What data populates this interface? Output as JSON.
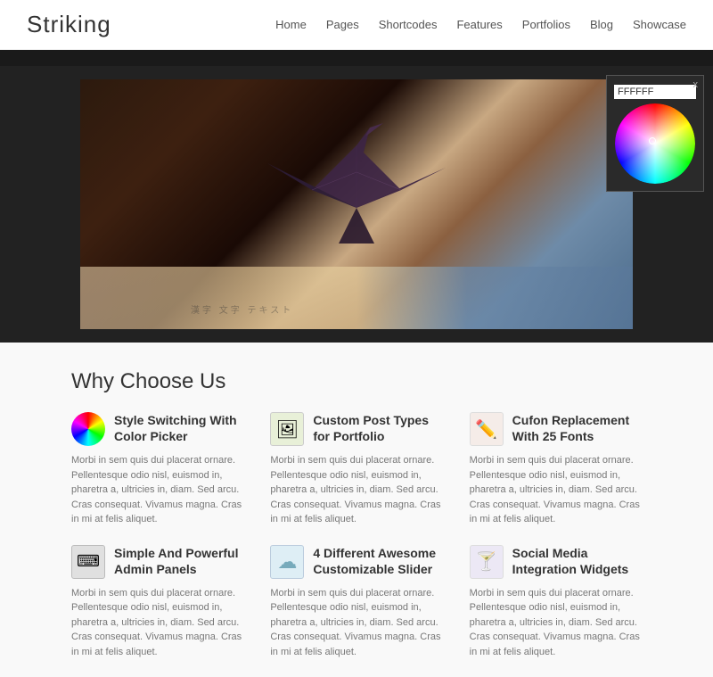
{
  "header": {
    "logo": "Striking",
    "nav": [
      {
        "label": "Home",
        "id": "home"
      },
      {
        "label": "Pages",
        "id": "pages"
      },
      {
        "label": "Shortcodes",
        "id": "shortcodes"
      },
      {
        "label": "Features",
        "id": "features"
      },
      {
        "label": "Portfolios",
        "id": "portfolios"
      },
      {
        "label": "Blog",
        "id": "blog"
      },
      {
        "label": "Showcase",
        "id": "showcase"
      }
    ]
  },
  "color_picker": {
    "hex_value": "FFFFFF",
    "close_label": "x"
  },
  "why_section": {
    "title": "Why Choose Us",
    "features": [
      {
        "id": "style-switching",
        "icon_type": "colorwheel",
        "title": "Style Switching With Color Picker",
        "desc": "Morbi in sem quis dui placerat ornare. Pellentesque odio nisl, euismod in, pharetra a, ultricies in, diam. Sed arcu. Cras consequat. Vivamus magna. Cras in mi at felis aliquet."
      },
      {
        "id": "custom-post",
        "icon_type": "custom-post",
        "title": "Custom Post Types for Portfolio",
        "desc": "Morbi in sem quis dui placerat ornare. Pellentesque odio nisl, euismod in, pharetra a, ultricies in, diam. Sed arcu. Cras consequat. Vivamus magna. Cras in mi at felis aliquet."
      },
      {
        "id": "cufon",
        "icon_type": "cufon",
        "title": "Cufon Replacement With 25 Fonts",
        "desc": "Morbi in sem quis dui placerat ornare. Pellentesque odio nisl, euismod in, pharetra a, ultricies in, diam. Sed arcu. Cras consequat. Vivamus magna. Cras in mi at felis aliquet."
      },
      {
        "id": "admin-panels",
        "icon_type": "admin",
        "title": "Simple And Powerful Admin Panels",
        "desc": "Morbi in sem quis dui placerat ornare. Pellentesque odio nisl, euismod in, pharetra a, ultricies in, diam. Sed arcu. Cras consequat. Vivamus magna. Cras in mi at felis aliquet."
      },
      {
        "id": "slider",
        "icon_type": "slider",
        "title": "4 Different Awesome Customizable Slider",
        "desc": "Morbi in sem quis dui placerat ornare. Pellentesque odio nisl, euismod in, pharetra a, ultricies in, diam. Sed arcu. Cras consequat. Vivamus magna. Cras in mi at felis aliquet."
      },
      {
        "id": "social",
        "icon_type": "social",
        "title": "Social Media Integration Widgets",
        "desc": "Morbi in sem quis dui placerat ornare. Pellentesque odio nisl, euismod in, pharetra a, ultricies in, diam. Sed arcu. Cras consequat. Vivamus magna. Cras in mi at felis aliquet."
      }
    ]
  }
}
